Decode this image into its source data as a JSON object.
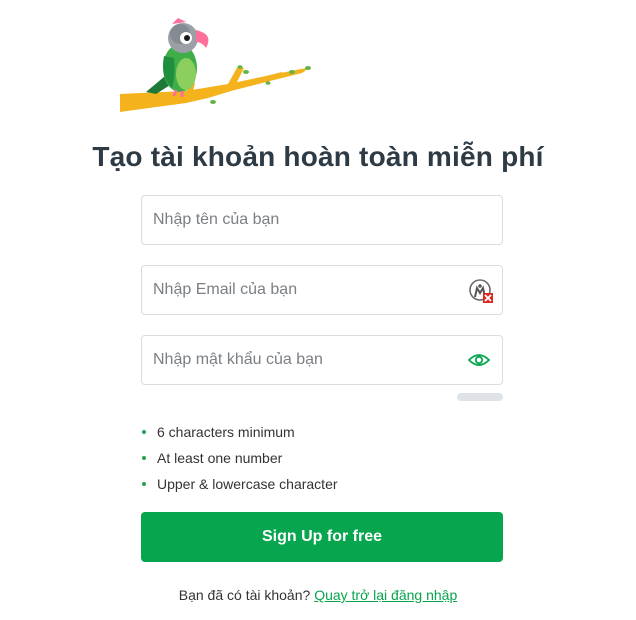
{
  "page_title": "Tạo tài khoản hoàn toàn miễn phí",
  "form": {
    "name_placeholder": "Nhập tên của bạn",
    "email_placeholder": "Nhập Email của bạn",
    "password_placeholder": "Nhập mật khẩu của bạn"
  },
  "password_rules": [
    "6 characters minimum",
    "At least one number",
    "Upper & lowercase character"
  ],
  "signup_label": "Sign Up for free",
  "login_prompt": "Bạn đã có tài khoản?",
  "login_link": "Quay trở lại đăng nhập",
  "icons": {
    "mascot": "parrot-on-branch-illustration",
    "email_field": "password-manager-autofill-icon",
    "password_field": "eye-icon"
  },
  "colors": {
    "accent": "#06a54e",
    "title": "#2e3b45",
    "bullet": "#21a355"
  },
  "password_strength": 0
}
